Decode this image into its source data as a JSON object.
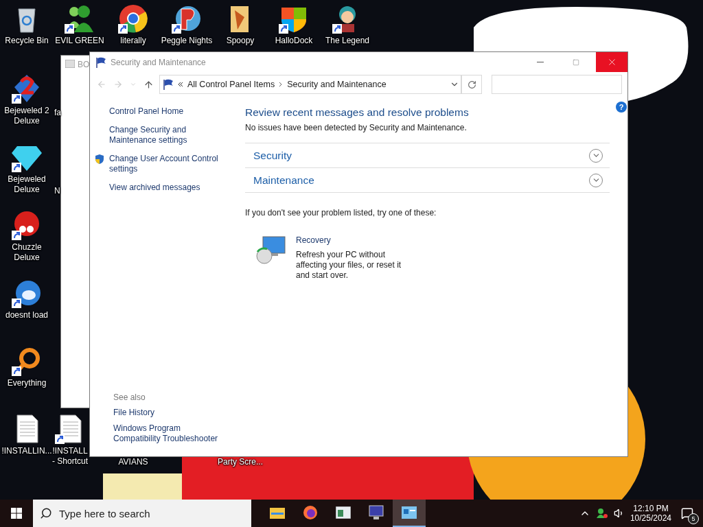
{
  "desktop_icons": [
    {
      "label": "Recycle Bin",
      "kind": "bin",
      "shortcut": false
    },
    {
      "label": "EVIL GREEN",
      "kind": "people",
      "shortcut": true
    },
    {
      "label": "literally",
      "kind": "browser",
      "shortcut": true
    },
    {
      "label": "Peggle Nights",
      "kind": "letter-ball",
      "shortcut": true
    },
    {
      "label": "Spoopy",
      "kind": "folder",
      "shortcut": false
    },
    {
      "label": "HalloDock",
      "kind": "shield",
      "shortcut": true
    },
    {
      "label": "The Legend",
      "kind": "character",
      "shortcut": true
    },
    {
      "label": "Bejeweled 2\nDeluxe",
      "kind": "gem-two",
      "shortcut": true
    },
    {
      "label": "Bejeweled\nDeluxe",
      "kind": "gem",
      "shortcut": true
    },
    {
      "label": "Chuzzle\nDeluxe",
      "kind": "creature",
      "shortcut": true
    },
    {
      "label": "doesnt load",
      "kind": "bird",
      "shortcut": true
    },
    {
      "label": "Everything",
      "kind": "ring",
      "shortcut": true
    },
    {
      "label": "!INSTALLIN...",
      "kind": "document",
      "shortcut": false
    },
    {
      "label": "!INSTALL\n- Shortcut",
      "kind": "document",
      "shortcut": true
    },
    {
      "label": "AVIANS",
      "kind": "none"
    },
    {
      "label": "Party Scre...",
      "kind": "none"
    },
    {
      "label": "fa"
    },
    {
      "label": "N"
    }
  ],
  "back_window": {
    "title": "BO"
  },
  "window": {
    "title": "Security and Maintenance",
    "address": [
      "All Control Panel Items",
      "Security and Maintenance"
    ],
    "sidebar": [
      {
        "label": "Control Panel Home",
        "shield": false
      },
      {
        "label": "Change Security and Maintenance settings",
        "shield": false
      },
      {
        "label": "Change User Account Control settings",
        "shield": true
      },
      {
        "label": "View archived messages",
        "shield": false
      }
    ],
    "heading": "Review recent messages and resolve problems",
    "summary": "No issues have been detected by Security and Maintenance.",
    "sections": [
      {
        "label": "Security",
        "expanded": false
      },
      {
        "label": "Maintenance",
        "expanded": false
      }
    ],
    "hint": "If you don't see your problem listed, try one of these:",
    "recovery": {
      "title": "Recovery",
      "description": "Refresh your PC without affecting your files, or reset it and start over."
    },
    "see_also": {
      "title": "See also",
      "links": [
        "File History",
        "Windows Program Compatibility Troubleshooter"
      ]
    },
    "help": "?"
  },
  "taskbar": {
    "search": {
      "placeholder": "Type here to search"
    },
    "apps": [
      {
        "kind": "folder",
        "selected": false
      },
      {
        "kind": "browser",
        "selected": false
      },
      {
        "kind": "window",
        "selected": false
      },
      {
        "kind": "monitor",
        "selected": false
      },
      {
        "kind": "panel",
        "selected": true
      }
    ],
    "time": "12:10 PM",
    "date": "10/25/2024",
    "notifications": "5"
  }
}
